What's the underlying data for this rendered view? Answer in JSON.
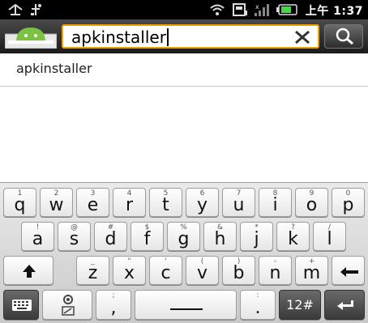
{
  "status_bar": {
    "time": "上午 1:37",
    "icons": [
      "usb-icon",
      "debug-icon",
      "wifi-icon",
      "sd-card-icon",
      "signal-icon",
      "battery-icon"
    ]
  },
  "search": {
    "value": "apkinstaller",
    "icons": {
      "clear": "close-icon",
      "search": "search-icon",
      "app": "android-app-icon"
    }
  },
  "suggestions": [
    {
      "text": "apkinstaller"
    }
  ],
  "keyboard": {
    "row1": [
      {
        "alt": "1",
        "main": "q"
      },
      {
        "alt": "2",
        "main": "w"
      },
      {
        "alt": "3",
        "main": "e"
      },
      {
        "alt": "4",
        "main": "r"
      },
      {
        "alt": "5",
        "main": "t"
      },
      {
        "alt": "6",
        "main": "y"
      },
      {
        "alt": "7",
        "main": "u"
      },
      {
        "alt": "8",
        "main": "i"
      },
      {
        "alt": "9",
        "main": "o"
      },
      {
        "alt": "0",
        "main": "p"
      }
    ],
    "row2": [
      {
        "alt": "!",
        "main": "a"
      },
      {
        "alt": "@",
        "main": "s"
      },
      {
        "alt": "#",
        "main": "d"
      },
      {
        "alt": "$",
        "main": "f"
      },
      {
        "alt": "%",
        "main": "g"
      },
      {
        "alt": "&",
        "main": "h"
      },
      {
        "alt": "*",
        "main": "j"
      },
      {
        "alt": "?",
        "main": "k"
      },
      {
        "alt": "/",
        "main": "l"
      }
    ],
    "row3": [
      {
        "alt": "_",
        "main": "z"
      },
      {
        "alt": "\"",
        "main": "x"
      },
      {
        "alt": "'",
        "main": "c"
      },
      {
        "alt": "(",
        "main": "v"
      },
      {
        "alt": ")",
        "main": "b"
      },
      {
        "alt": "-",
        "main": "n"
      },
      {
        "alt": "+",
        "main": "m"
      }
    ],
    "row4": {
      "semicolon_alt": ";",
      "comma": ",",
      "colon_alt": ":",
      "period": ".",
      "mode_label": "12#"
    }
  }
}
